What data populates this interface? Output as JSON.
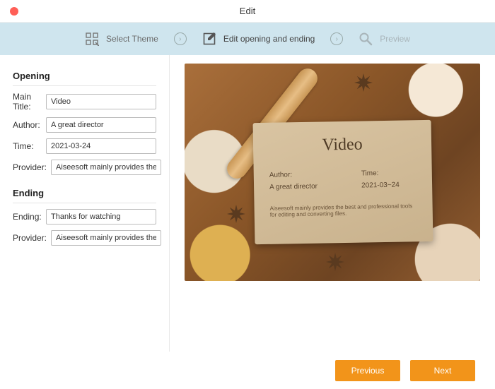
{
  "window": {
    "title": "Edit"
  },
  "steps": {
    "select_theme": "Select Theme",
    "edit_opening_ending": "Edit opening and ending",
    "preview": "Preview"
  },
  "sidebar": {
    "opening_head": "Opening",
    "ending_head": "Ending",
    "labels": {
      "main_title": "Main Title:",
      "author": "Author:",
      "time": "Time:",
      "provider": "Provider:",
      "ending": "Ending:"
    },
    "values": {
      "main_title": "Video",
      "author": "A great director",
      "time": "2021-03-24",
      "provider_opening": "Aiseesoft mainly provides the t",
      "ending": "Thanks for watching",
      "provider_ending": "Aiseesoft mainly provides the t"
    }
  },
  "preview": {
    "title": "Video",
    "author_label": "Author:",
    "time_label": "Time:",
    "author": "A great director",
    "time": "2021-03~24",
    "footer": "Aiseesoft mainly provides the best and professional tools for editing and converting files."
  },
  "footer": {
    "previous": "Previous",
    "next": "Next"
  }
}
